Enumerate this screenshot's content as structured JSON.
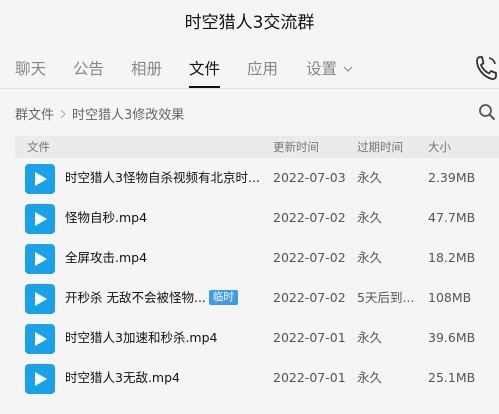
{
  "window": {
    "title": "时空猎人3交流群"
  },
  "tabs": [
    {
      "label": "聊天"
    },
    {
      "label": "公告"
    },
    {
      "label": "相册"
    },
    {
      "label": "文件",
      "active": true
    },
    {
      "label": "应用"
    },
    {
      "label": "设置"
    }
  ],
  "breadcrumb": {
    "root": "群文件",
    "current": "时空猎人3修改效果"
  },
  "table": {
    "headers": {
      "name": "文件",
      "updated": "更新时间",
      "expires": "过期时间",
      "size": "大小"
    },
    "rows": [
      {
        "name": "时空猎人3怪物自杀视频有北京时...",
        "updated": "2022-07-03",
        "expires": "永久",
        "size": "2.39MB"
      },
      {
        "name": "怪物自秒.mp4",
        "updated": "2022-07-02",
        "expires": "永久",
        "size": "47.7MB"
      },
      {
        "name": "全屏攻击.mp4",
        "updated": "2022-07-02",
        "expires": "永久",
        "size": "18.2MB"
      },
      {
        "name": "开秒杀 无敌不会被怪物...",
        "tag": "临时",
        "updated": "2022-07-02",
        "expires": "5天后到...",
        "size": "108MB"
      },
      {
        "name": "时空猎人3加速和秒杀.mp4",
        "updated": "2022-07-01",
        "expires": "永久",
        "size": "39.6MB"
      },
      {
        "name": "时空猎人3无敌.mp4",
        "updated": "2022-07-01",
        "expires": "永久",
        "size": "25.1MB"
      }
    ]
  },
  "colors": {
    "accent": "#1aa2e8",
    "tag": "#3e9be8",
    "background": "#f5f5f5"
  },
  "icons": {
    "phone": "phone-icon",
    "search": "search-icon",
    "play": "play-icon",
    "chevron": "chevron-down-icon",
    "breadcrumb_sep": "chevron-right-icon"
  }
}
